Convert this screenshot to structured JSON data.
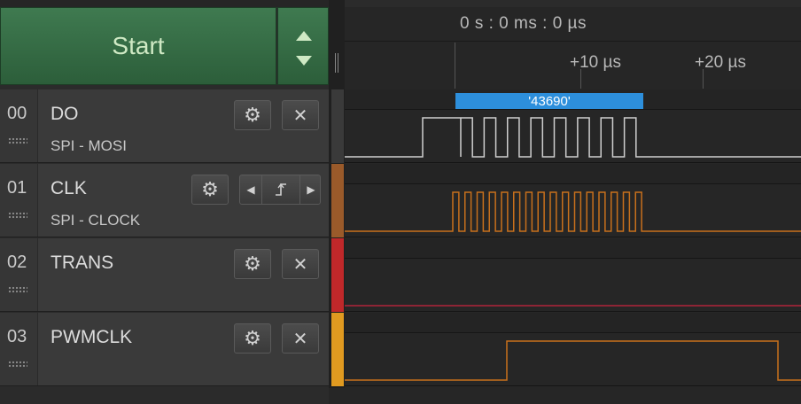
{
  "controls": {
    "start_label": "Start"
  },
  "timeline": {
    "origin_label": "0 s : 0 ms : 0 µs",
    "ticks": [
      "+10 µs",
      "+20 µs"
    ]
  },
  "channels": [
    {
      "num": "00",
      "name": "DO",
      "analyzer": "SPI - MOSI",
      "color": "#3a3a3a",
      "wave_color": "#cfcfcf"
    },
    {
      "num": "01",
      "name": "CLK",
      "analyzer": "SPI - CLOCK",
      "color": "#9a5a2a",
      "wave_color": "#c8701c"
    },
    {
      "num": "02",
      "name": "TRANS",
      "analyzer": "",
      "color": "#c0282a",
      "wave_color": "#b0243a"
    },
    {
      "num": "03",
      "name": "PWMCLK",
      "analyzer": "",
      "color": "#e09a20",
      "wave_color": "#c8701c"
    }
  ],
  "decode": {
    "value": "'43690'",
    "color": "#2d8fdc"
  },
  "icons": {
    "settings": "gear-icon",
    "remove": "close-icon",
    "prev": "chevron-left-icon",
    "next": "chevron-right-icon",
    "edge": "falling-edge-icon",
    "scroll_up": "arrow-up-icon",
    "scroll_down": "arrow-down-icon"
  }
}
